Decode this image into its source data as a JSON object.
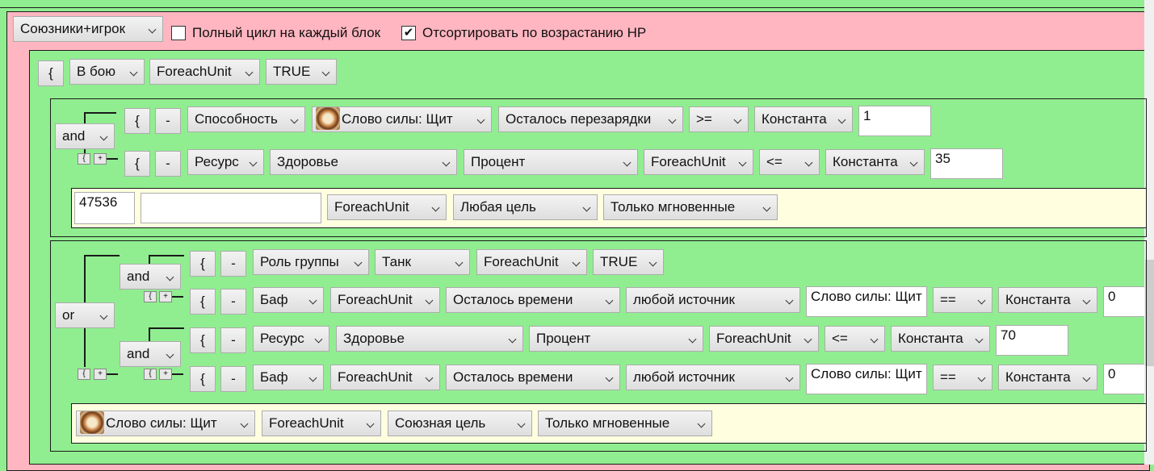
{
  "header": {
    "filter_select": "Союзники+игрок",
    "full_cycle_checked": false,
    "full_cycle_label": "Полный цикл на каждый блок",
    "sort_checked": true,
    "sort_label": "Отсортировать по возрастанию HP",
    "checkmark": "✔"
  },
  "block": {
    "bracket": "{",
    "state": "В бою",
    "target": "ForeachUnit",
    "value": "TRUE"
  },
  "rule1": {
    "group_op": "and",
    "cond1": {
      "bracket": "{",
      "minus": "-",
      "type": "Способность",
      "spell": "Слово силы: Щит",
      "field": "Осталось перезарядки",
      "op": ">=",
      "source": "Константа",
      "value": "1"
    },
    "cond2": {
      "bracket": "{",
      "minus": "-",
      "type": "Ресурс",
      "resource": "Здоровье",
      "mode": "Процент",
      "unit": "ForeachUnit",
      "op": "<=",
      "source": "Константа",
      "value": "35"
    },
    "mini_a": "{",
    "mini_b": "+",
    "action": {
      "spell_id": "47536",
      "spell_name": "",
      "unit": "ForeachUnit",
      "target": "Любая цель",
      "cast": "Только мгновенные"
    }
  },
  "rule2": {
    "outer_op": "or",
    "group1": {
      "op": "and",
      "cond1": {
        "bracket": "{",
        "minus": "-",
        "type": "Роль группы",
        "role": "Танк",
        "unit": "ForeachUnit",
        "value": "TRUE"
      },
      "cond2": {
        "bracket": "{",
        "minus": "-",
        "type": "Баф",
        "unit": "ForeachUnit",
        "field": "Осталось времени",
        "source_filter": "любой источник",
        "spell": "Слово силы: Щит",
        "op": "==",
        "source": "Константа",
        "value": "0"
      }
    },
    "group2": {
      "op": "and",
      "cond1": {
        "bracket": "{",
        "minus": "-",
        "type": "Ресурс",
        "resource": "Здоровье",
        "mode": "Процент",
        "unit": "ForeachUnit",
        "op": "<=",
        "source": "Константа",
        "value": "70"
      },
      "cond2": {
        "bracket": "{",
        "minus": "-",
        "type": "Баф",
        "unit": "ForeachUnit",
        "field": "Осталось времени",
        "source_filter": "любой источник",
        "spell": "Слово силы: Щит",
        "op": "==",
        "source": "Константа",
        "value": "0"
      }
    },
    "mini_a": "{",
    "mini_b": "+",
    "action": {
      "spell": "Слово силы: Щит",
      "unit": "ForeachUnit",
      "target": "Союзная цель",
      "cast": "Только мгновенные"
    }
  },
  "colors": {
    "pink": "#ffb6c1",
    "green": "#90ee90",
    "cream": "#ffffe0"
  }
}
